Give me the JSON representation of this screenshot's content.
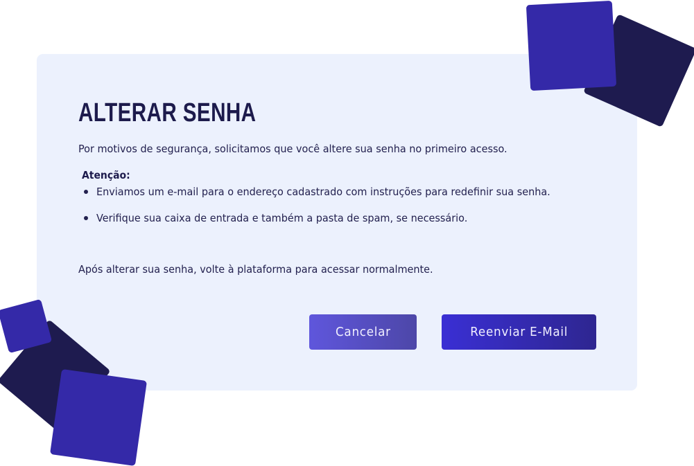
{
  "dialog": {
    "title": "ALTERAR SENHA",
    "intro": "Por motivos de segurança, solicitamos que você altere sua senha no primeiro acesso.",
    "attention_label": "Atenção:",
    "bullets": [
      "Enviamos um e-mail para o endereço cadastrado com instruções para redefinir sua senha.",
      "Verifique sua caixa de entrada e também a pasta de spam, se necessário."
    ],
    "after_text": "Após alterar sua senha, volte à plataforma para acessar normalmente.",
    "buttons": {
      "cancel": "Cancelar",
      "resend": "Reenviar E-Mail"
    }
  },
  "colors": {
    "card_background": "#ecf1fd",
    "title_text": "#1d1b4c",
    "body_text": "#23214f",
    "deco_light": "#3429a8",
    "deco_dark": "#1e1b4f",
    "cancel_button": "#5f56dc",
    "resend_button": "#3a2fd4"
  },
  "icons": {
    "decorations": [
      "square-shape-decoration",
      "square-shape-decoration",
      "square-shape-decoration",
      "square-shape-decoration",
      "square-shape-decoration"
    ]
  }
}
